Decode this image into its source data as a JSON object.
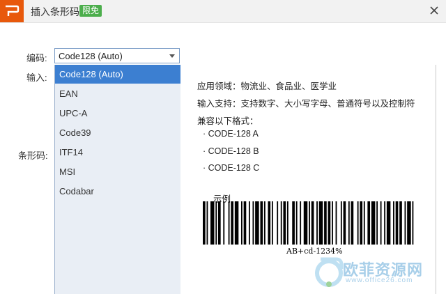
{
  "window": {
    "title": "插入条形码",
    "badge": "限免",
    "accent_color": "#e8590c",
    "badge_color": "#4cae4c"
  },
  "form": {
    "encoding_label": "编码:",
    "input_label": "输入:",
    "barcode_label": "条形码:",
    "selected_value": "Code128 (Auto)"
  },
  "dropdown": {
    "selected_color": "#3c7fd1",
    "options": [
      "Code128 (Auto)",
      "EAN",
      "UPC-A",
      "Code39",
      "ITF14",
      "MSI",
      "Codabar"
    ]
  },
  "info": {
    "application": "应用领域：物流业、食品业、医学业",
    "input_support": "输入支持：支持数字、大小写字母、普通符号以及控制符",
    "compatible": "兼容以下格式：",
    "formats": [
      "· CODE-128 A",
      "· CODE-128 B",
      "· CODE-128 C"
    ],
    "example_label": "示例",
    "example_caption": "AB+cd-1234%"
  },
  "watermark": {
    "brand": "欧菲资源网",
    "url": "www.office26.com"
  }
}
